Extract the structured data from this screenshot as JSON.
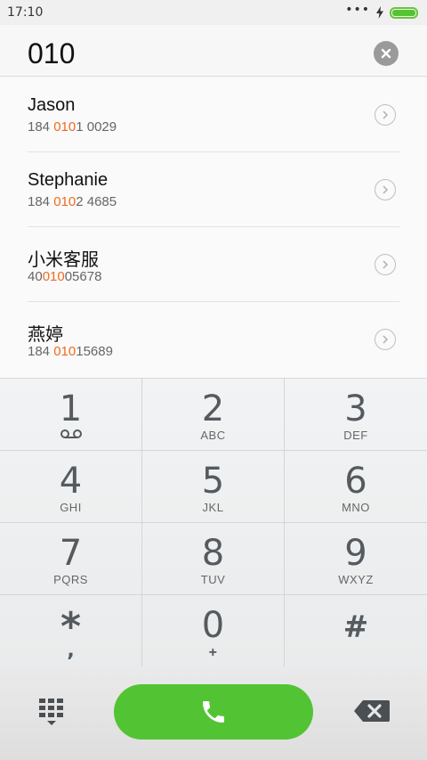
{
  "status_bar": {
    "time": "17:10",
    "signal_dots": "•••",
    "battery_level": 1.0
  },
  "search": {
    "query": "010"
  },
  "results": [
    {
      "name": "Jason",
      "number_pre": "184 ",
      "number_match": "010",
      "number_post": "1 0029"
    },
    {
      "name": "Stephanie",
      "number_pre": "184 ",
      "number_match": "010",
      "number_post": "2 4685"
    },
    {
      "name": "小米客服",
      "number_pre": "40",
      "number_match": "010",
      "number_post": "05678"
    },
    {
      "name": "燕婷",
      "number_pre": "184 ",
      "number_match": "010",
      "number_post": "15689"
    }
  ],
  "keypad": {
    "k1": {
      "digit": "1",
      "sub_icon": "voicemail-icon"
    },
    "k2": {
      "digit": "2",
      "sub": "ABC"
    },
    "k3": {
      "digit": "3",
      "sub": "DEF"
    },
    "k4": {
      "digit": "4",
      "sub": "GHI"
    },
    "k5": {
      "digit": "5",
      "sub": "JKL"
    },
    "k6": {
      "digit": "6",
      "sub": "MNO"
    },
    "k7": {
      "digit": "7",
      "sub": "PQRS"
    },
    "k8": {
      "digit": "8",
      "sub": "TUV"
    },
    "k9": {
      "digit": "9",
      "sub": "WXYZ"
    },
    "kstar": {
      "digit": "*",
      "sub": ","
    },
    "k0": {
      "digit": "0",
      "sub": "+"
    },
    "khash": {
      "digit": "#"
    }
  },
  "colors": {
    "call_green": "#52c433",
    "match_orange": "#f06a1e",
    "battery_green": "#54c532"
  }
}
